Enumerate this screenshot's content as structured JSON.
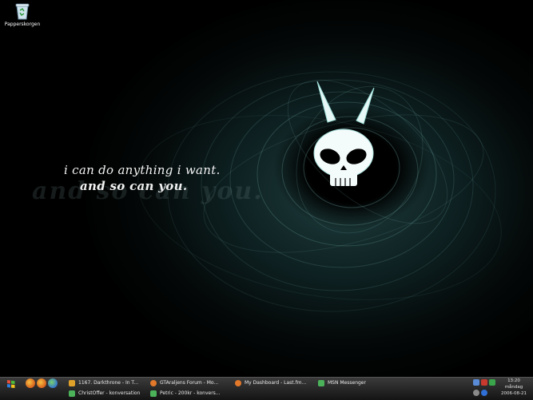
{
  "desktop": {
    "icons": [
      {
        "label": "Papperskorgen",
        "icon": "recycle-bin-icon"
      }
    ],
    "wallpaper": {
      "line1": "i can do anything i want.",
      "line2": "and so can you.",
      "shadow_text": "and so can you.",
      "accent": "#8fd4d0"
    }
  },
  "taskbar": {
    "start_icon": "windows-logo-icon",
    "quicklaunch": [
      "firefox-icon",
      "firefox-icon",
      "msn-icon"
    ],
    "tasks_row1": [
      {
        "label": "1167. Darkthrone - In T...",
        "icon": "winamp-icon"
      },
      {
        "label": "GTAraljens Forum - Mo...",
        "icon": "firefox-icon"
      },
      {
        "label": "My Dashboard - Last.fm...",
        "icon": "firefox-icon"
      },
      {
        "label": "MSN Messenger",
        "icon": "msn-icon"
      }
    ],
    "tasks_row2": [
      {
        "label": "ChristOffer - konversation",
        "icon": "msn-chat-icon"
      },
      {
        "label": "Petric - 200kr - konvers...",
        "icon": "msn-chat-icon"
      }
    ],
    "clock": {
      "time": "13:20",
      "day": "måndag",
      "date": "2006-08-21"
    }
  }
}
